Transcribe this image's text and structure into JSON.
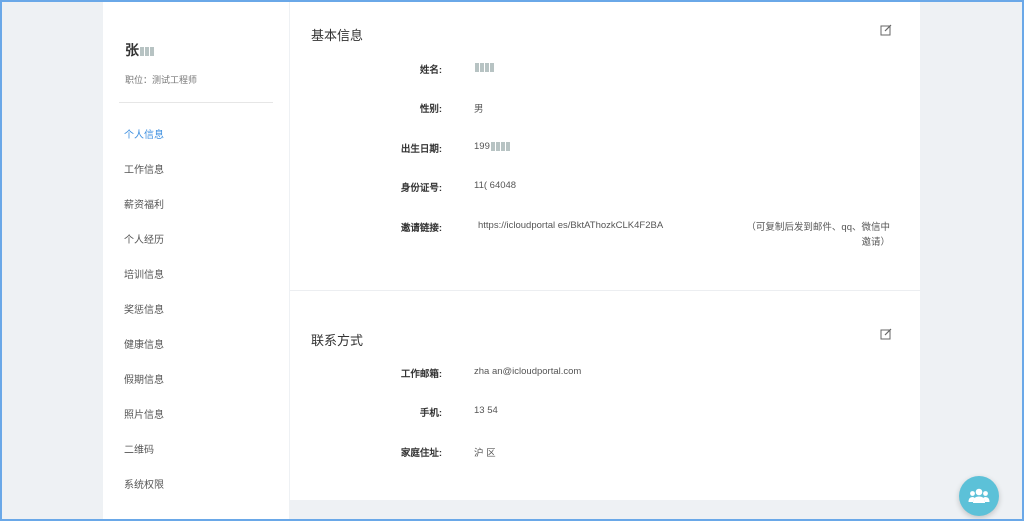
{
  "profile": {
    "name": "张",
    "role": "职位：测试工程师"
  },
  "menu": [
    {
      "label": "个人信息",
      "active": true
    },
    {
      "label": "工作信息",
      "active": false
    },
    {
      "label": "薪资福利",
      "active": false
    },
    {
      "label": "个人经历",
      "active": false
    },
    {
      "label": "培训信息",
      "active": false
    },
    {
      "label": "奖惩信息",
      "active": false
    },
    {
      "label": "健康信息",
      "active": false
    },
    {
      "label": "假期信息",
      "active": false
    },
    {
      "label": "照片信息",
      "active": false
    },
    {
      "label": "二维码",
      "active": false
    },
    {
      "label": "系统权限",
      "active": false
    }
  ],
  "basic": {
    "title": "基本信息",
    "fields": [
      {
        "label": "姓名:",
        "value": ""
      },
      {
        "label": "性别:",
        "value": "男"
      },
      {
        "label": "出生日期:",
        "value": "199"
      },
      {
        "label": "身份证号:",
        "value": "11( 64048"
      },
      {
        "label": "邀请链接:",
        "value": "https://icloudportal es/BktAThozkCLK4F2BA"
      }
    ],
    "invite_note_line1": "（可复制后发到邮件、qq、微信中",
    "invite_note_line2": "邀请）"
  },
  "contact": {
    "title": "联系方式",
    "fields": [
      {
        "label": "工作邮箱:",
        "value": "zha an@icloudportal.com"
      },
      {
        "label": "手机:",
        "value": "13 54"
      },
      {
        "label": "家庭住址:",
        "value": "沪 区"
      }
    ]
  },
  "colors": {
    "accent": "#3d8fe0",
    "fab": "#5cc1d8",
    "background": "#eef1f4"
  },
  "icons": {
    "edit": "edit-icon",
    "fab": "users-icon"
  }
}
